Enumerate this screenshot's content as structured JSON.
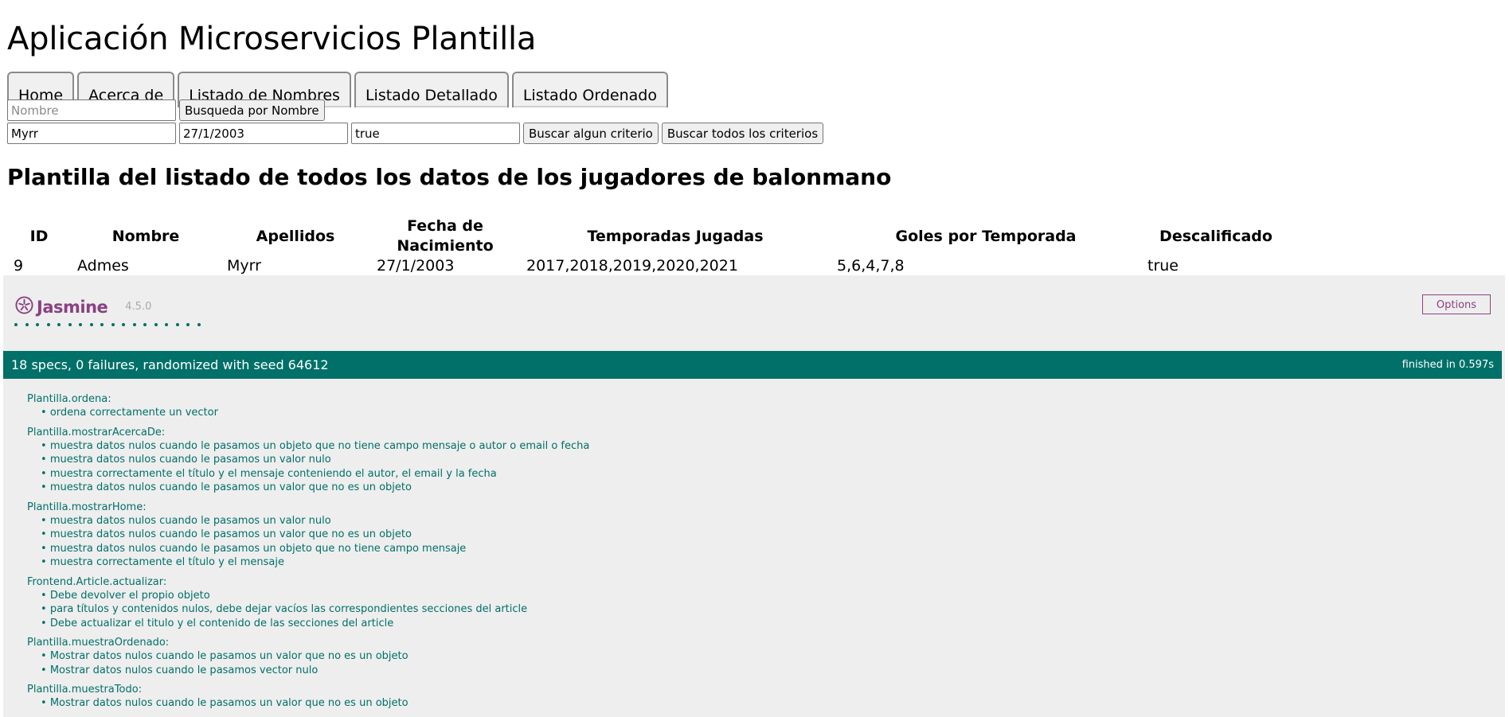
{
  "app": {
    "title": "Aplicación Microservicios Plantilla"
  },
  "tabs": [
    "Home",
    "Acerca de",
    "Listado de Nombres",
    "Listado Detallado",
    "Listado Ordenado"
  ],
  "search": {
    "name_placeholder": "Nombre",
    "name_button": "Busqueda por Nombre",
    "criteria_values": [
      "Myrr",
      "27/1/2003",
      "true"
    ],
    "any_button": "Buscar algun criterio",
    "all_button": "Buscar todos los criterios"
  },
  "section": {
    "title": "Plantilla del listado de todos los datos de los jugadores de balonmano"
  },
  "table": {
    "headers": [
      "ID",
      "Nombre",
      "Apellidos",
      "Fecha de Nacimiento",
      "Temporadas Jugadas",
      "Goles por Temporada",
      "Descalificado"
    ],
    "rows": [
      [
        "9",
        "Admes",
        "Myrr",
        "27/1/2003",
        "2017,2018,2019,2020,2021",
        "5,6,4,7,8",
        "true"
      ]
    ]
  },
  "jasmine": {
    "logo": "Jasmine",
    "version": "4.5.0",
    "options_label": "Options",
    "summary": "18 specs, 0 failures, randomized with seed 64612",
    "duration": "finished in 0.597s",
    "passed_count": 18,
    "accent_color": "#007069",
    "brand_color": "#8a4182",
    "suites": [
      {
        "name": "Plantilla.ordena:",
        "specs": [
          "ordena correctamente un vector"
        ]
      },
      {
        "name": "Plantilla.mostrarAcercaDe:",
        "specs": [
          "muestra datos nulos cuando le pasamos un objeto que no tiene campo mensaje o autor o email o fecha",
          "muestra datos nulos cuando le pasamos un valor nulo",
          "muestra correctamente el título y el mensaje conteniendo el autor, el email y la fecha",
          "muestra datos nulos cuando le pasamos un valor que no es un objeto"
        ]
      },
      {
        "name": "Plantilla.mostrarHome:",
        "specs": [
          "muestra datos nulos cuando le pasamos un valor nulo",
          "muestra datos nulos cuando le pasamos un valor que no es un objeto",
          "muestra datos nulos cuando le pasamos un objeto que no tiene campo mensaje",
          "muestra correctamente el título y el mensaje"
        ]
      },
      {
        "name": "Frontend.Article.actualizar:",
        "specs": [
          "Debe devolver el propio objeto",
          "para títulos y contenidos nulos, debe dejar vacíos las correspondientes secciones del article",
          "Debe actualizar el titulo y el contenido de las secciones del article"
        ]
      },
      {
        "name": "Plantilla.muestraOrdenado:",
        "specs": [
          "Mostrar datos nulos cuando le pasamos un valor que no es un objeto",
          "Mostrar datos nulos cuando le pasamos vector nulo"
        ]
      },
      {
        "name": "Plantilla.muestraTodo:",
        "specs": [
          "Mostrar datos nulos cuando le pasamos un valor que no es un objeto"
        ]
      }
    ]
  }
}
